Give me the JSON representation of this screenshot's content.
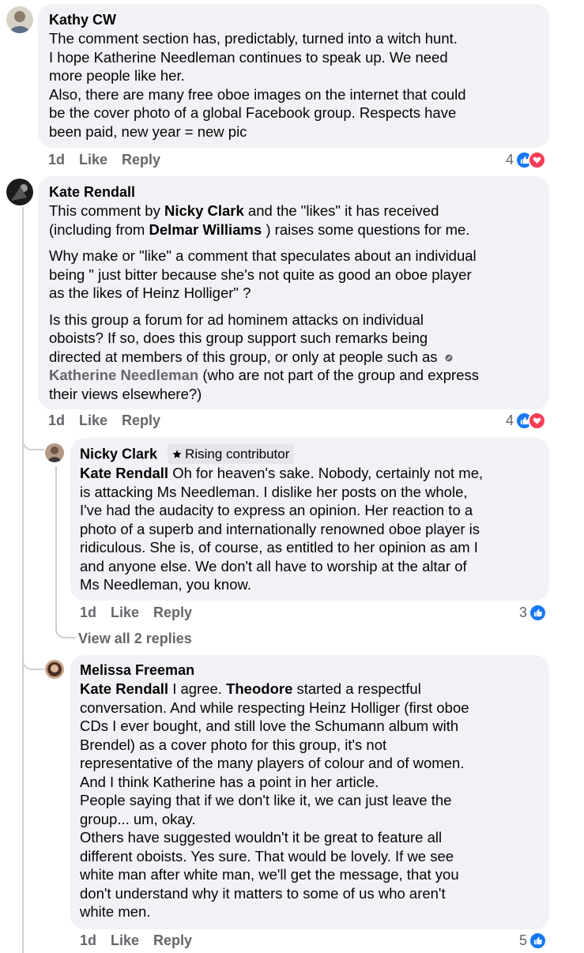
{
  "comments": [
    {
      "author": "Kathy CW",
      "lines": [
        "The comment section has, predictably, turned into a witch hunt.",
        "I hope Katherine Needleman continues to speak up. We need",
        "more people like her.",
        "Also, there are many free oboe images on the internet that could",
        "be the cover photo of a global Facebook group. Respects have",
        "been paid, new year = new pic"
      ],
      "time": "1d",
      "like": "Like",
      "reply": "Reply",
      "reactions": "4"
    },
    {
      "author": "Kate Rendall",
      "p1": {
        "a": "This comment by ",
        "m1": "Nicky Clark",
        "b": " and the \"likes\" it has received",
        "c": "(including from ",
        "m2": "Delmar Williams",
        "d": " ) raises some questions for me."
      },
      "p2": [
        "Why make or \"like\" a comment that speculates about an individual",
        "being \" just bitter because she's not quite as good an oboe player",
        "as the likes of Heinz Holliger\" ?"
      ],
      "p3": {
        "l1": "Is this group a forum for ad hominem attacks on individual",
        "l2": "oboists? If so, does this group support such remarks being",
        "l3": "directed at members of this group, or only at people such as",
        "m": "Katherine Needleman",
        "l4": " (who are not part of the group and express",
        "l5": "their views elsewhere?)"
      },
      "time": "1d",
      "like": "Like",
      "reply": "Reply",
      "reactions": "4"
    },
    {
      "author": "Nicky Clark",
      "badge": "Rising contributor",
      "mention": "Kate Rendall",
      "first": " Oh for heaven's sake. Nobody, certainly not me,",
      "lines": [
        "is attacking Ms Needleman. I dislike her posts on the whole,",
        "I've had the audacity to express an opinion. Her reaction to a",
        "photo of a superb and internationally renowned oboe player is",
        "ridiculous. She is, of course, as entitled to her opinion as am I",
        "and anyone else. We don't all have to worship at the altar of",
        "Ms Needleman, you know."
      ],
      "time": "1d",
      "like": "Like",
      "reply": "Reply",
      "reactions": "3"
    },
    {
      "author": "Melissa Freeman",
      "mention": "Kate Rendall",
      "first_a": " I agree. ",
      "first_bold": "Theodore",
      "first_b": " started a respectful",
      "lines": [
        "conversation. And while respecting Heinz Holliger (first oboe",
        "CDs I ever bought, and still love the Schumann album with",
        "Brendel) as a cover photo for this group, it's not",
        "representative of the many players of colour and of women.",
        "And I think Katherine has a point in her article.",
        "People saying that if we don't like it, we can just leave the",
        "group... um, okay.",
        "Others have suggested wouldn't it be great to feature all",
        "different oboists. Yes sure. That would be lovely. If we see",
        "white man after white man, we'll get the message, that you",
        "don't understand why it matters to some of us who aren't",
        "white men."
      ],
      "time": "1d",
      "like": "Like",
      "reply": "Reply",
      "reactions": "5"
    }
  ],
  "view_all_replies": "View all 2 replies",
  "colors": {
    "like": "#1877f2",
    "love": "#f33e58",
    "bubble": "#f0f2f5",
    "meta": "#65676b"
  }
}
